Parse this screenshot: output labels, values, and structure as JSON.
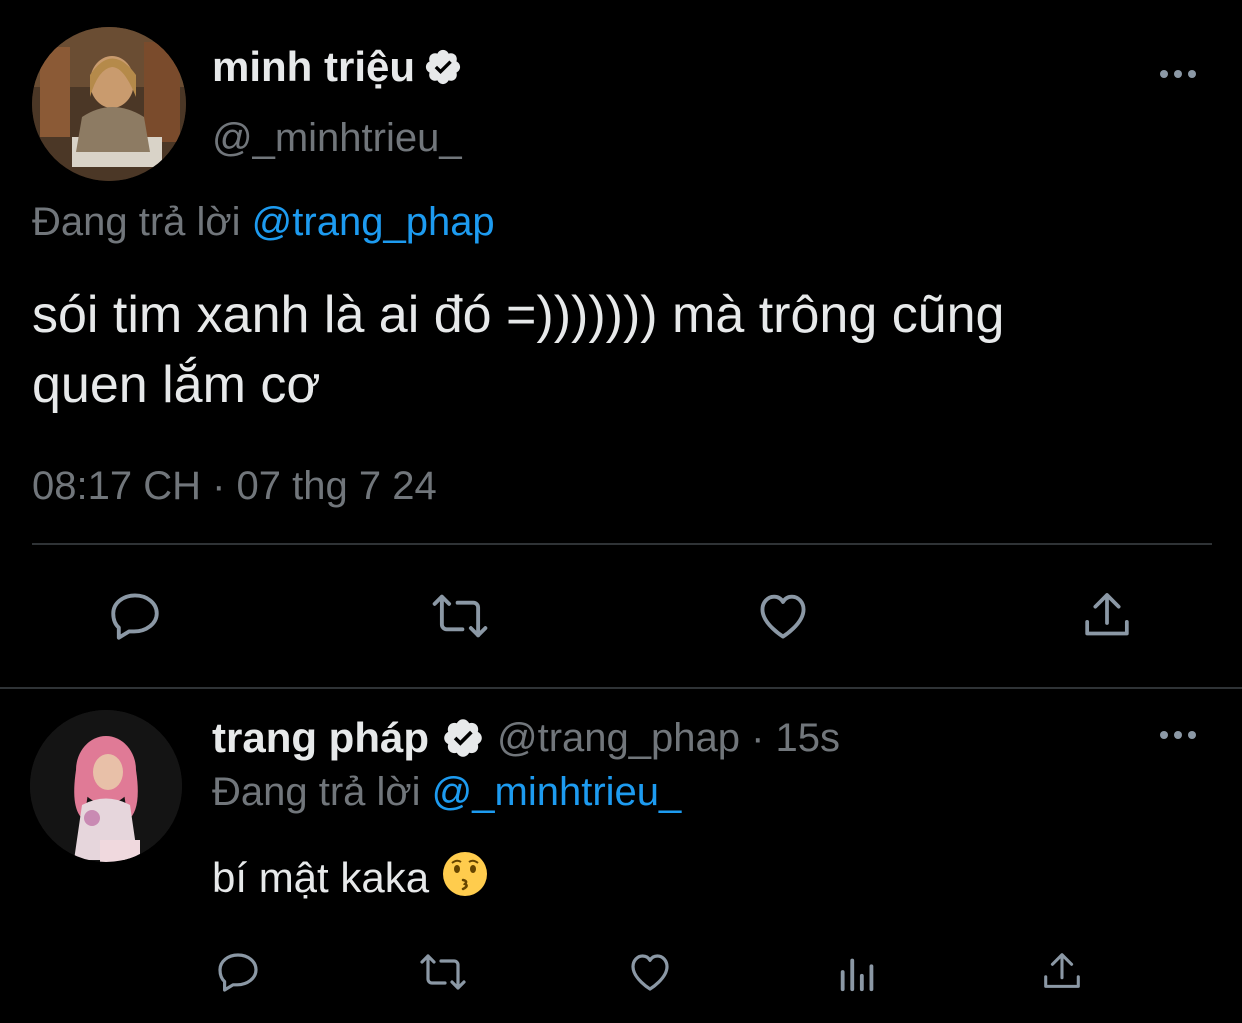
{
  "main_tweet": {
    "display_name": "minh triệu",
    "handle": "@_minhtrieu_",
    "reply_prefix": "Đang trả lời",
    "reply_to": "@trang_phap",
    "text_line1": "sói tim xanh là ai đó =))))))) mà trông cũng",
    "text_line2": "quen lắm cơ",
    "timestamp": "08:17 CH · 07 thg 7 24"
  },
  "reply_tweet": {
    "display_name": "trang pháp",
    "handle_time": "@trang_phap · 15s",
    "reply_prefix": "Đang trả lời",
    "reply_to": "@_minhtrieu_",
    "text": "bí mật kaka"
  },
  "icons": {
    "main_actions": [
      "reply-icon",
      "retweet-icon",
      "like-icon",
      "share-icon"
    ],
    "reply_actions": [
      "reply-icon",
      "retweet-icon",
      "like-icon",
      "analytics-icon",
      "share-icon"
    ]
  },
  "colors": {
    "background": "#000000",
    "text": "#e7e9ea",
    "muted": "#71767b",
    "link": "#1d9bf0",
    "divider": "#2f3336"
  }
}
